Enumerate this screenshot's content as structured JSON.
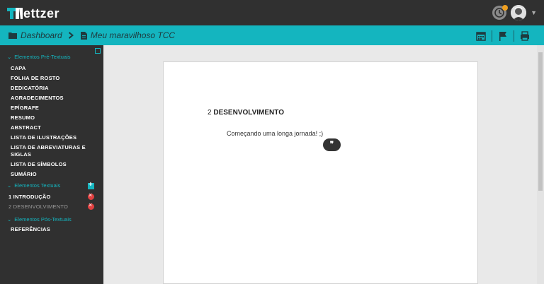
{
  "app": {
    "logo_text": "ettzer"
  },
  "colors": {
    "accent": "#14b5bf",
    "dark": "#303030",
    "alert": "#e04040",
    "badge": "#f0a020"
  },
  "breadcrumb": {
    "root": "Dashboard",
    "document": "Meu maravilhoso TCC"
  },
  "toolbar_icons": [
    "calendar-icon",
    "flag-icon",
    "print-icon"
  ],
  "sidebar": {
    "pre_textual": {
      "title": "Elementos Pré-Textuais",
      "items": [
        "CAPA",
        "FOLHA DE ROSTO",
        "DEDICATÓRIA",
        "AGRADECIMENTOS",
        "EPÍGRAFE",
        "RESUMO",
        "ABSTRACT",
        "LISTA DE ILUSTRAÇÕES",
        "LISTA DE ABREVIATURAS E",
        "SIGLAS",
        "LISTA DE SÍMBOLOS",
        "SUMÁRIO"
      ]
    },
    "textual": {
      "title": "Elementos Textuais",
      "items": [
        {
          "number": "1",
          "label": "INTRODUÇÃO"
        },
        {
          "number": "2",
          "label": "DESENVOLVIMENTO"
        }
      ]
    },
    "post_textual": {
      "title": "Elementos Pós-Textuais",
      "items": [
        "REFERÊNCIAS"
      ]
    }
  },
  "document": {
    "heading_number": "2",
    "heading_title": "DESENVOLVIMENTO",
    "paragraph": "Começando uma longa jornada! ;)",
    "quote_glyph": "❞"
  }
}
